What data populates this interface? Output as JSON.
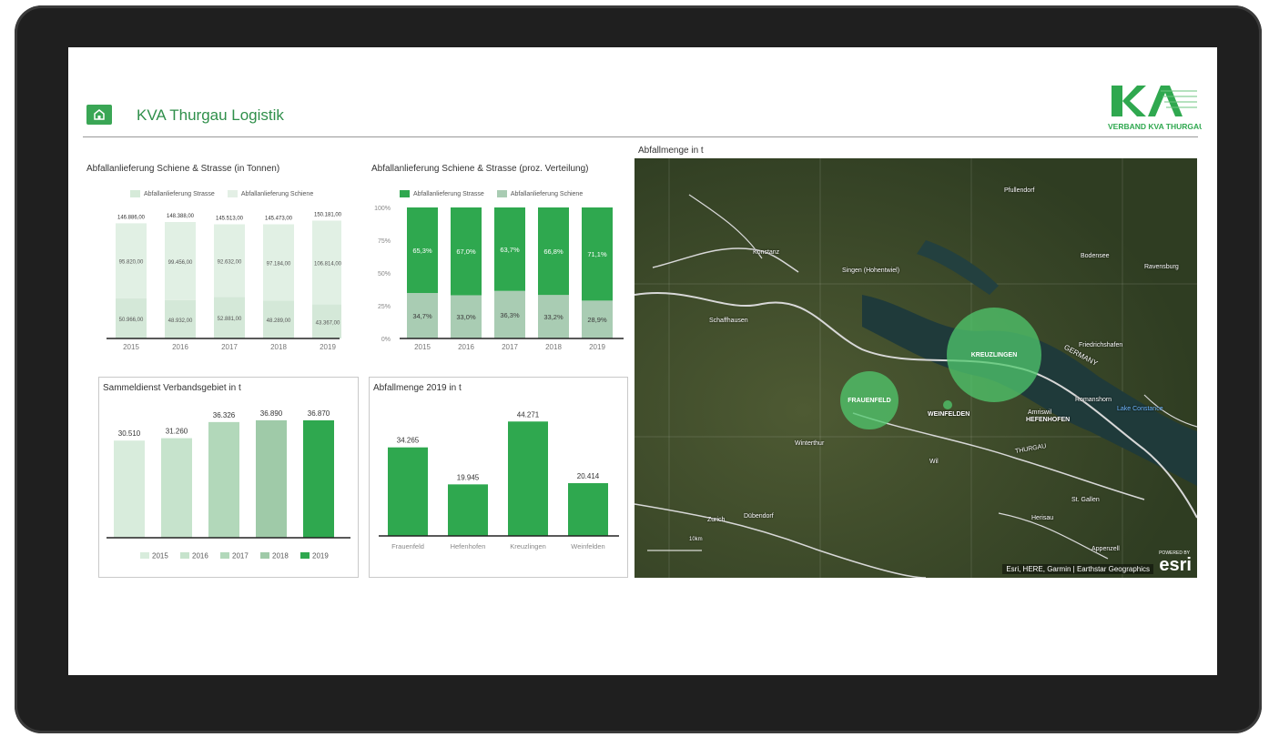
{
  "header": {
    "title": "KVA Thurgau Logistik",
    "logo_text": "VERBAND KVA THURGAU"
  },
  "colors": {
    "accent": "#2fa84f",
    "strasse": "#2fa84f",
    "schiene": "#a9ccb3",
    "light": "#d6ead9"
  },
  "map": {
    "title": "Abfallmenge in t",
    "attribution": "Esri, HERE, Garmin | Earthstar Geographics",
    "brand": "esri",
    "powered_by": "POWERED BY",
    "scale": "10km",
    "places": [
      "Friedrichshafen",
      "Singen (Hohentwiel)",
      "Schaffhausen",
      "Winterthur",
      "Zurich",
      "Dübendorf",
      "Wil",
      "St. Gallen",
      "Herisau",
      "Romanshorn",
      "Amriswil",
      "Appenzell",
      "Ravensburg",
      "Konstanz",
      "Pfullendorf",
      "Bodensee",
      "Lake Constance"
    ],
    "bubbles": [
      {
        "label": "KREUZLINGEN"
      },
      {
        "label": "FRAUENFELD"
      },
      {
        "label": "WEINFELDEN"
      },
      {
        "label": "HEFENHOFEN"
      }
    ],
    "border_labels": [
      "GERMANY",
      "THURGAU"
    ]
  },
  "chart_data": [
    {
      "type": "bar",
      "title": "Abfallanlieferung Schiene & Strasse (in Tonnen)",
      "categories": [
        "2015",
        "2016",
        "2017",
        "2018",
        "2019"
      ],
      "series": [
        {
          "name": "Abfallanlieferung Strasse",
          "values": [
            95820,
            99456,
            92632,
            97184,
            106814
          ],
          "labels": [
            "95.820,00",
            "99.456,00",
            "92.632,00",
            "97.184,00",
            "106.814,00"
          ]
        },
        {
          "name": "Abfallanlieferung Schiene",
          "values": [
            50966,
            48932,
            52881,
            48289,
            43367
          ],
          "labels": [
            "50.966,00",
            "48.932,00",
            "52.881,00",
            "48.289,00",
            "43.367,00"
          ]
        }
      ],
      "totals": [
        146886,
        148388,
        145513,
        145473,
        150181
      ],
      "total_labels": [
        "146.886,00",
        "148.388,00",
        "145.513,00",
        "145.473,00",
        "150.181,00"
      ]
    },
    {
      "type": "bar",
      "title": "Abfallanlieferung Schiene & Strasse (proz. Verteilung)",
      "categories": [
        "2015",
        "2016",
        "2017",
        "2018",
        "2019"
      ],
      "yticks": [
        "100%",
        "75%",
        "50%",
        "25%",
        "0%"
      ],
      "series": [
        {
          "name": "Abfallanlieferung Strasse",
          "values": [
            65.3,
            67.0,
            63.7,
            66.8,
            71.1
          ],
          "labels": [
            "65,3%",
            "67,0%",
            "63,7%",
            "66,8%",
            "71,1%"
          ]
        },
        {
          "name": "Abfallanlieferung Schiene",
          "values": [
            34.7,
            33.0,
            36.3,
            33.2,
            28.9
          ],
          "labels": [
            "34,7%",
            "33,0%",
            "36,3%",
            "33,2%",
            "28,9%"
          ]
        }
      ]
    },
    {
      "type": "bar",
      "title": "Sammeldienst Verbandsgebiet in t",
      "categories": [
        "2015",
        "2016",
        "2017",
        "2018",
        "2019"
      ],
      "values": [
        30510,
        31260,
        36326,
        36890,
        36870
      ],
      "labels": [
        "30.510",
        "31.260",
        "36.326",
        "36.890",
        "36.870"
      ],
      "colors": [
        "#d8ecdc",
        "#c6e3cc",
        "#b2d8ba",
        "#9fcaa8",
        "#2fa84f"
      ]
    },
    {
      "type": "bar",
      "title": "Abfallmenge 2019 in t",
      "categories": [
        "Frauenfeld",
        "Hefenhofen",
        "Kreuzlingen",
        "Weinfelden"
      ],
      "values": [
        34265,
        19945,
        44271,
        20414
      ],
      "labels": [
        "34.265",
        "19.945",
        "44.271",
        "20.414"
      ]
    }
  ]
}
